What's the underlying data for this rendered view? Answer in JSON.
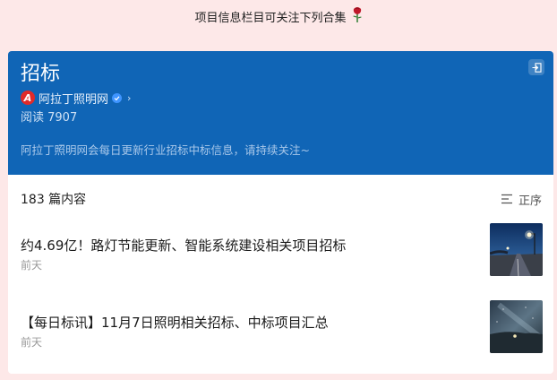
{
  "banner": {
    "text": "项目信息栏目可关注下列合集"
  },
  "header": {
    "title": "招标",
    "account_name": "阿拉丁照明网",
    "account_logo_letter": "A",
    "reads": "阅读 7907",
    "description": "阿拉丁照明网会每日更新行业招标中标信息，请持续关注~"
  },
  "list": {
    "count": "183 篇内容",
    "sort_label": "正序",
    "items": [
      {
        "title": "约4.69亿！路灯节能更新、智能系统建设相关项目招标",
        "time": "前天",
        "thumb": "street-lamp-photo"
      },
      {
        "title": "【每日标讯】11月7日照明相关招标、中标项目汇总",
        "time": "前天",
        "thumb": "night-sky-photo"
      }
    ]
  },
  "colors": {
    "header_bg": "#1065b6",
    "page_bg": "#fde8e8",
    "logo_red": "#e02a2a",
    "verified_blue": "#3f95ff"
  }
}
